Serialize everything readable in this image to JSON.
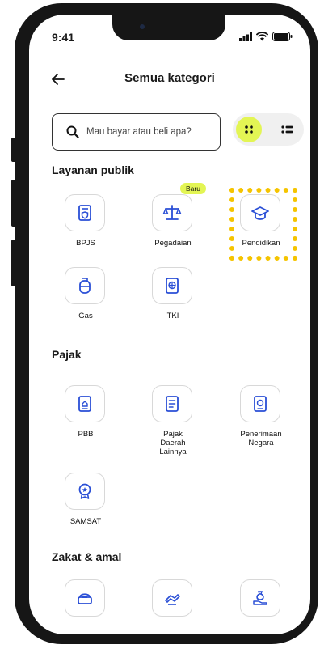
{
  "status": {
    "time": "9:41"
  },
  "header": {
    "title": "Semua kategori"
  },
  "search": {
    "placeholder": "Mau bayar atau beli apa?"
  },
  "sections": [
    {
      "title": "Layanan publik",
      "items": [
        {
          "label": "BPJS",
          "icon": "card-shield-icon"
        },
        {
          "label": "Pegadaian",
          "icon": "scale-icon",
          "badge": "Baru"
        },
        {
          "label": "Pendidikan",
          "icon": "graduation-cap-icon"
        },
        {
          "label": "Gas",
          "icon": "gas-cylinder-icon"
        },
        {
          "label": "TKI",
          "icon": "passport-icon"
        }
      ]
    },
    {
      "title": "Pajak",
      "items": [
        {
          "label": "PBB",
          "icon": "document-house-icon"
        },
        {
          "label": "Pajak Daerah Lainnya",
          "icon": "document-list-icon"
        },
        {
          "label": "Penerimaan Negara",
          "icon": "document-money-icon"
        },
        {
          "label": "SAMSAT",
          "icon": "award-badge-icon"
        }
      ]
    },
    {
      "title": "Zakat & amal",
      "items": [
        {
          "icon": "donation-box-icon"
        },
        {
          "icon": "hand-giving-icon"
        },
        {
          "icon": "money-bag-hand-icon"
        }
      ]
    }
  ],
  "colors": {
    "accent": "#e3f554",
    "icon": "#2a4fd6",
    "highlight": "#f5c400"
  }
}
